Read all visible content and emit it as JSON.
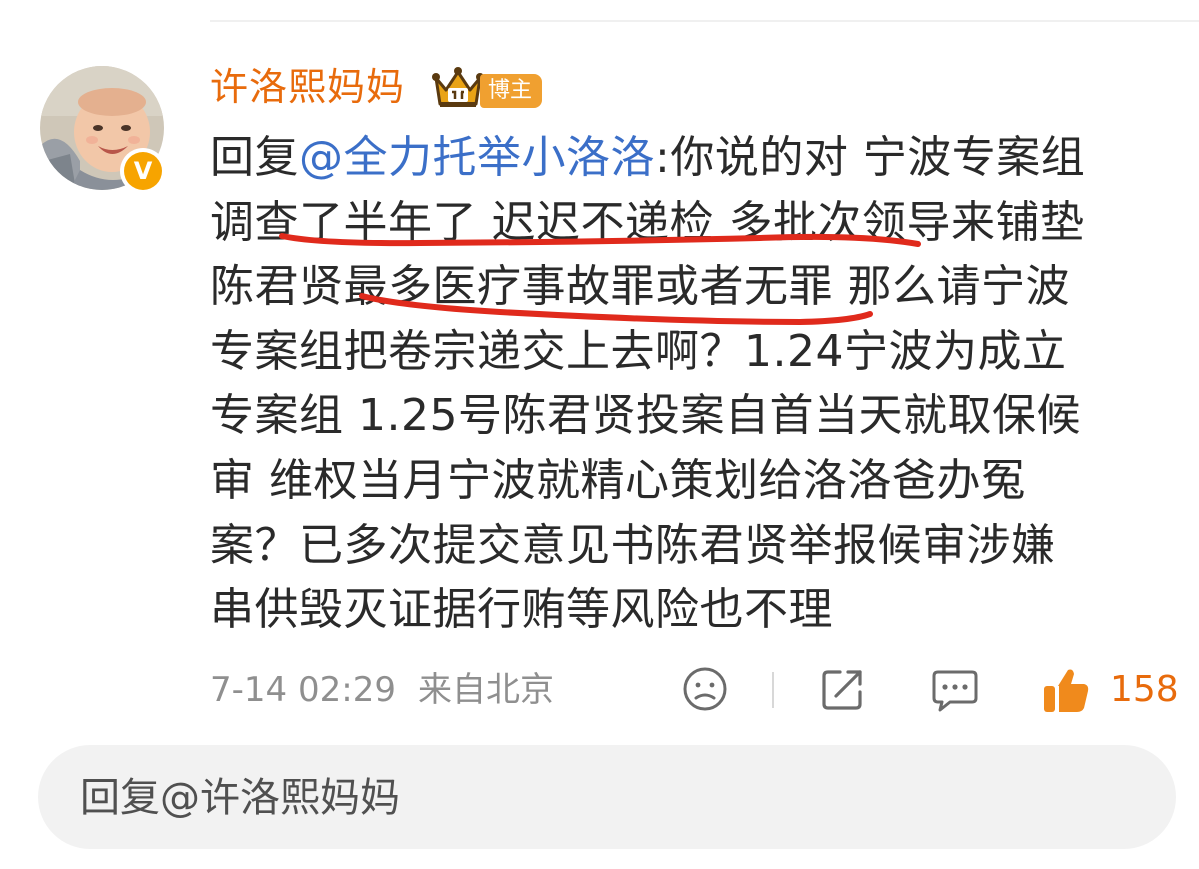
{
  "comment": {
    "username": "许洛熙妈妈",
    "badge_label": "博主",
    "verified_badge": "V",
    "text_lines": [
      {
        "prefix": "回复",
        "mention": "@全力托举小洛洛",
        "rest": ":你说的对 宁波专案组"
      },
      {
        "text": "调查了半年了 迟迟不递检 多批次领导来铺垫"
      },
      {
        "text": "陈君贤最多医疗事故罪或者无罪  那么请宁波"
      },
      {
        "text": "专案组把卷宗递交上去啊？1.24宁波为成立"
      },
      {
        "text": "专案组 1.25号陈君贤投案自首当天就取保候"
      },
      {
        "text": "审  维权当月宁波就精心策划给洛洛爸办冤"
      },
      {
        "text": "案？已多次提交意见书陈君贤举报候审涉嫌"
      },
      {
        "text": "串供毁灭证据行贿等风险也不理"
      }
    ],
    "time": "7-14 02:29",
    "location": "来自北京",
    "like_count": "158",
    "icons": {
      "dislike": "sad-face-icon",
      "share": "share-icon",
      "comment": "comment-icon",
      "like": "thumbs-up-icon",
      "crown": "crown-icon"
    },
    "colors": {
      "username": "#e86b0c",
      "mention": "#3b6fc8",
      "like": "#e86b0c",
      "annotation": "#e02a1c",
      "badge": "#f0a030"
    }
  },
  "reply_bar": {
    "placeholder": "回复@许洛熙妈妈"
  }
}
